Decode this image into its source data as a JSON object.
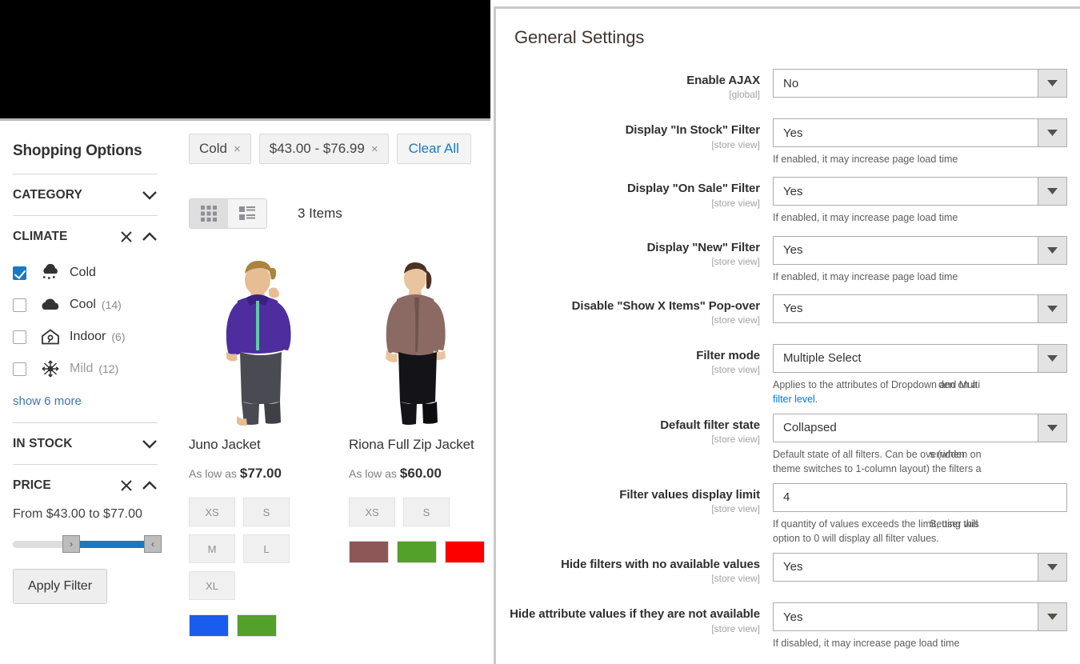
{
  "storefront": {
    "sidebar": {
      "title": "Shopping Options",
      "groups": [
        {
          "name": "CATEGORY",
          "state": "collapsed",
          "clearable": false
        },
        {
          "name": "CLIMATE",
          "state": "expanded",
          "clearable": true
        },
        {
          "name": "IN STOCK",
          "state": "collapsed",
          "clearable": false
        },
        {
          "name": "PRICE",
          "state": "expanded",
          "clearable": true
        }
      ],
      "climate_options": [
        {
          "label": "Cold",
          "count": "",
          "checked": true,
          "icon": "snow-cloud-icon",
          "dim": false
        },
        {
          "label": "Cool",
          "count": "(14)",
          "checked": false,
          "icon": "cloud-icon",
          "dim": false
        },
        {
          "label": "Indoor",
          "count": "(6)",
          "checked": false,
          "icon": "house-icon",
          "dim": false
        },
        {
          "label": "Mild",
          "count": "(12)",
          "checked": false,
          "icon": "sun-snow-icon",
          "dim": true
        }
      ],
      "show_more": "show 6 more",
      "price_range_text": "From $43.00 to $77.00",
      "apply_filter": "Apply Filter",
      "slider": {
        "min_handle_glyph": "›",
        "max_handle_glyph": "‹"
      }
    },
    "toolbar": {
      "chips": [
        {
          "label": "Cold",
          "remove_glyph": "×"
        },
        {
          "label": "$43.00 - $76.99",
          "remove_glyph": "×"
        }
      ],
      "clear_all": "Clear All",
      "item_count": "3 Items",
      "view_modes": [
        {
          "name": "grid",
          "active": true
        },
        {
          "name": "list",
          "active": false
        }
      ]
    },
    "products": [
      {
        "name": "Juno Jacket",
        "price_prefix": "As low as",
        "price": "$77.00",
        "sizes": [
          "XS",
          "S",
          "M",
          "L",
          "XL"
        ],
        "colors": [
          "#1a5ced",
          "#53a02b"
        ]
      },
      {
        "name": "Riona Full Zip Jacket",
        "price_prefix": "As low as",
        "price": "$60.00",
        "sizes": [
          "XS",
          "S"
        ],
        "colors": [
          "#8d5758",
          "#53a02b",
          "#fc0000"
        ]
      }
    ]
  },
  "admin": {
    "section_title": "General Settings",
    "fields": [
      {
        "label": "Enable AJAX",
        "scope": "[global]",
        "type": "select",
        "value": "No",
        "hint": ""
      },
      {
        "label": "Display \"In Stock\" Filter",
        "scope": "[store view]",
        "type": "select",
        "value": "Yes",
        "hint": "If enabled, it may increase page load time"
      },
      {
        "label": "Display \"On Sale\" Filter",
        "scope": "[store view]",
        "type": "select",
        "value": "Yes",
        "hint": "If enabled, it may increase page load time"
      },
      {
        "label": "Display \"New\" Filter",
        "scope": "[store view]",
        "type": "select",
        "value": "Yes",
        "hint": "If enabled, it may increase page load time"
      },
      {
        "label": "Disable \"Show X Items\" Pop-over",
        "scope": "[store view]",
        "type": "select",
        "value": "Yes",
        "hint": ""
      },
      {
        "label": "Filter mode",
        "scope": "[store view]",
        "type": "select",
        "value": "Multiple Select",
        "hint": "Applies to the attributes of Dropdown and Multi",
        "hint_overlap": "den on a",
        "hint_link": "filter level",
        "hint_tail": "."
      },
      {
        "label": "Default filter state",
        "scope": "[store view]",
        "type": "select",
        "value": "Collapsed",
        "hint": "Default state of all filters. Can be overridden on",
        "hint_overlap": "s (when",
        "hint_line2": "theme switches to 1-column layout) the filters a"
      },
      {
        "label": "Filter values display limit",
        "scope": "[store view]",
        "type": "input",
        "value": "4",
        "hint": "If quantity of values exceeds the limit, user will",
        "hint_overlap": "Setting this",
        "hint_line2": "option to 0 will display all filter values."
      },
      {
        "label": "Hide filters with no available values",
        "scope": "[store view]",
        "type": "select",
        "value": "Yes",
        "hint": ""
      },
      {
        "label": "Hide attribute values if they are not available",
        "scope": "[store view]",
        "type": "select",
        "value": "Yes",
        "hint": "If disabled, it may increase page load time"
      }
    ]
  },
  "colors": {
    "accent_blue": "#1979c3",
    "admin_link": "#007bdb",
    "admin_heading": "#41362f",
    "scope_gray": "#a6a29e",
    "swatch_blue": "#1a5ced",
    "swatch_green": "#53a02b",
    "swatch_red": "#fc0000",
    "swatch_mauve": "#8d5758"
  }
}
